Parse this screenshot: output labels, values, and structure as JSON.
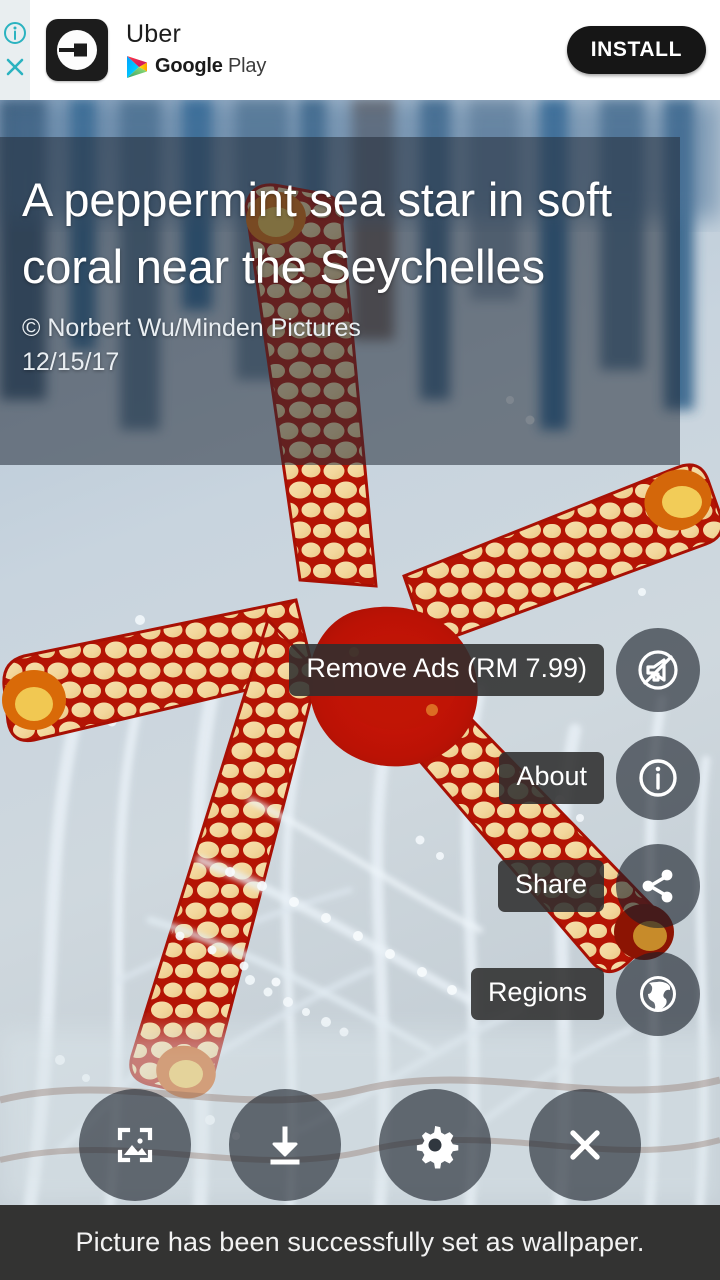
{
  "ad": {
    "app_name": "Uber",
    "store_label_bold": "Google",
    "store_label_light": "Play",
    "install_label": "INSTALL",
    "info_icon": "info-icon",
    "close_icon": "close-icon",
    "app_icon": "uber-logo-icon",
    "store_icon": "google-play-icon",
    "accent_color": "#2bb3c0",
    "button_color": "#161616"
  },
  "image_info": {
    "title": "A peppermint sea star in soft coral near the Seychelles",
    "credit": "© Norbert Wu/Minden Pictures",
    "date": "12/15/17"
  },
  "actions": [
    {
      "label": "Remove Ads (RM 7.99)",
      "icon": "no-ads-icon",
      "name": "remove-ads"
    },
    {
      "label": "About",
      "icon": "info-circle-icon",
      "name": "about"
    },
    {
      "label": "Share",
      "icon": "share-icon",
      "name": "share"
    },
    {
      "label": "Regions",
      "icon": "globe-icon",
      "name": "regions"
    }
  ],
  "toolbar": [
    {
      "name": "set-wallpaper",
      "icon": "image-frame-icon"
    },
    {
      "name": "download",
      "icon": "download-icon"
    },
    {
      "name": "settings",
      "icon": "gear-icon"
    },
    {
      "name": "close",
      "icon": "close-x-icon"
    }
  ],
  "toast": {
    "message": "Picture has been successfully set as wallpaper."
  },
  "colors": {
    "scrim": "rgba(34,44,56,0.55)",
    "pill": "rgba(47,47,47,0.88)",
    "fab": "rgba(26,33,42,0.62)",
    "toast_bg": "#333332"
  }
}
